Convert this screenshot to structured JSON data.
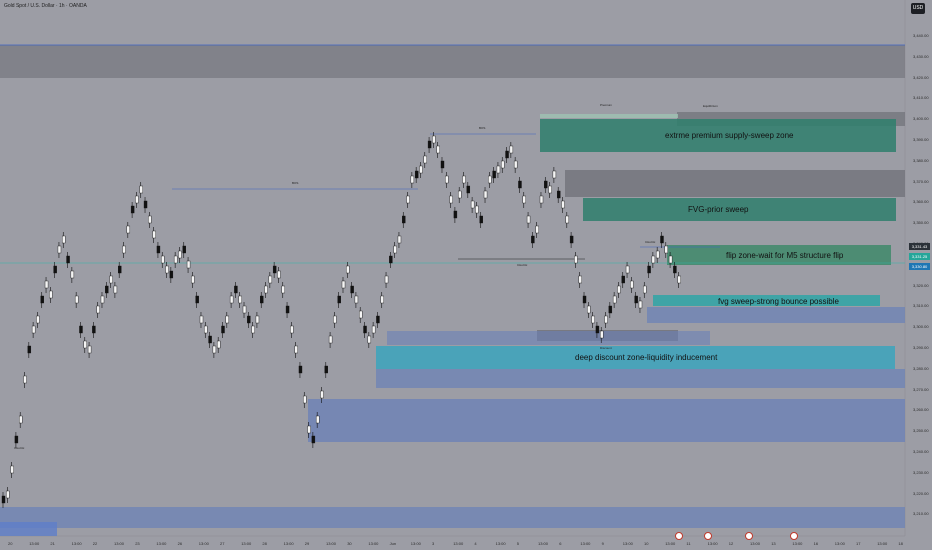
{
  "header": {
    "symbol_title": "Gold Spot / U.S. Dollar · 1h · OANDA",
    "currency_badge": "USD"
  },
  "price_axis": [
    "3,440.00",
    "3,430.00",
    "3,420.00",
    "3,410.00",
    "3,400.00",
    "3,390.00",
    "3,380.00",
    "3,370.00",
    "3,360.00",
    "3,350.00",
    "3,340.00",
    "3,330.00",
    "3,320.00",
    "3,310.00",
    "3,300.00",
    "3,290.00",
    "3,280.00",
    "3,270.00",
    "3,260.00",
    "3,250.00",
    "3,240.00",
    "3,230.00",
    "3,220.00",
    "3,210.00"
  ],
  "price_tags": [
    {
      "text": "3,331.43",
      "color": "#2b3138"
    },
    {
      "text": "3,331.25",
      "color": "#26a69a"
    },
    {
      "text": "3,330.80",
      "color": "#1f77b4"
    }
  ],
  "time_axis": [
    "20",
    "13:00",
    "21",
    "13:00",
    "22",
    "13:00",
    "23",
    "13:00",
    "26",
    "13:00",
    "27",
    "13:00",
    "28",
    "13:00",
    "29",
    "13:00",
    "30",
    "13:00",
    "Jun",
    "13:00",
    "3",
    "13:00",
    "4",
    "13:00",
    "5",
    "13:00",
    "6",
    "13:00",
    "9",
    "13:00",
    "10",
    "13:00",
    "11",
    "13:00",
    "12",
    "13:00",
    "13",
    "13:00",
    "16",
    "13:00",
    "17",
    "13:00",
    "18"
  ],
  "zones": {
    "premium": "extrme premium supply-sweep zone",
    "fvg_prior": "FVG-prior sweep",
    "flip": "flip zone-wait for M5 structure flip",
    "fvg_sweep": "fvg sweep-strong bounce possible",
    "discount": "deep discount zone-liquidity inducement"
  },
  "markers": {
    "bos": "BOS",
    "choch": "CHoCH",
    "premium": "Premium",
    "discount": "Discount",
    "equilibrium": "Equilibrium"
  },
  "colors": {
    "background": "#9c9da5",
    "candle": "#111111",
    "supply_zone": "#2f7f6c",
    "demand_zone": "#3b8ea6",
    "blue_zone": "#6a80b8",
    "gray_zone": "#6f7078"
  }
}
